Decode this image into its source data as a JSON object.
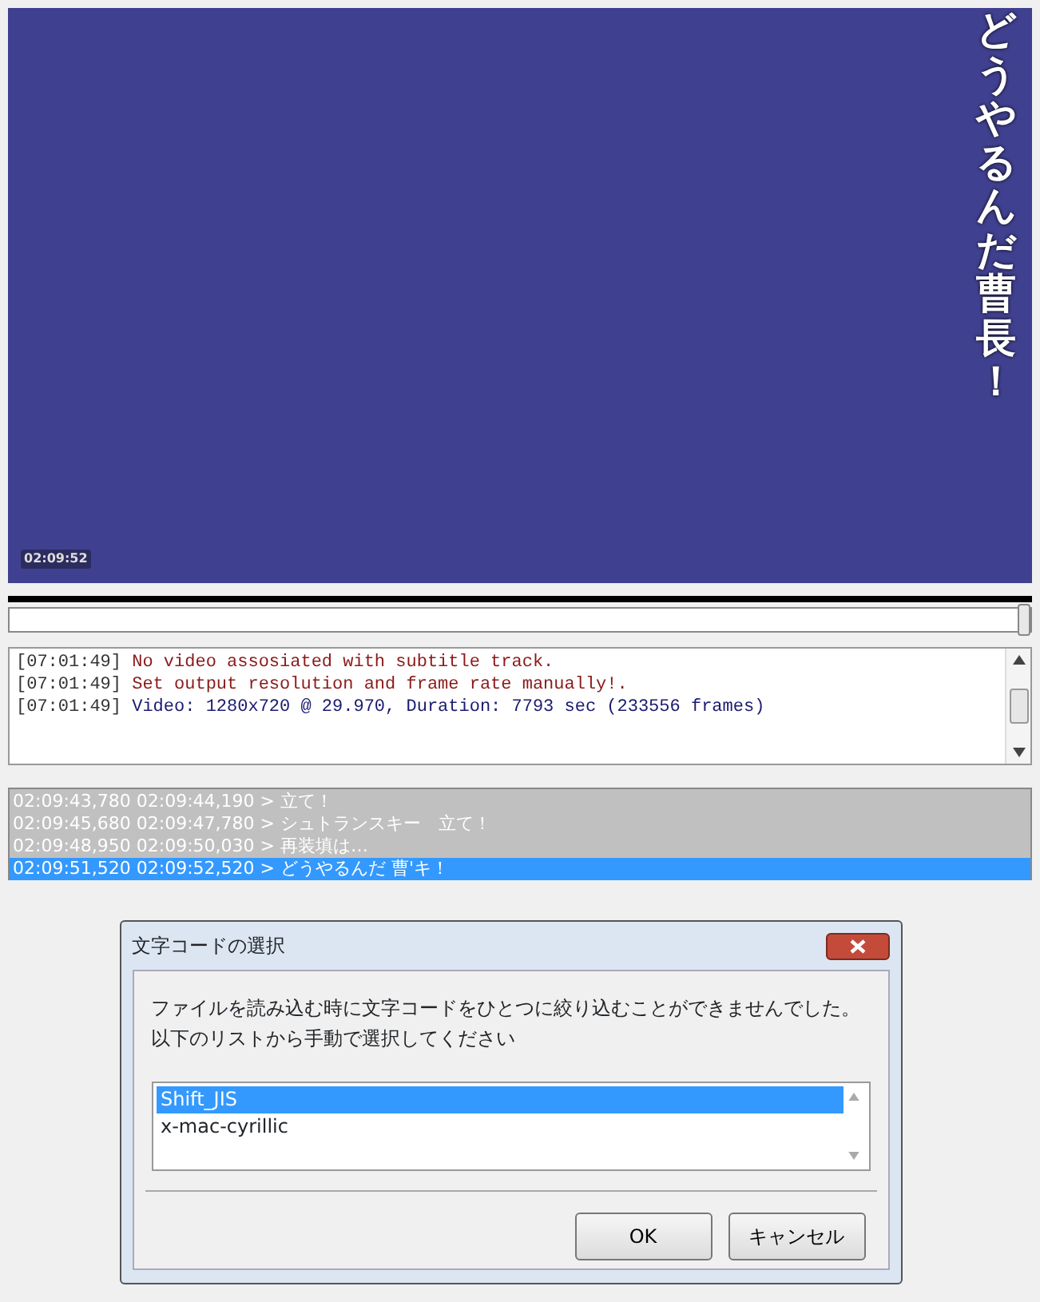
{
  "video": {
    "subtitle": "どうやるんだ曹長！",
    "timecode": "02:09:52"
  },
  "seek": {
    "level": 1.0
  },
  "log": [
    {
      "time": "[07:01:49]",
      "message": "No video assosiated with subtitle track.",
      "kind": "warning"
    },
    {
      "time": "[07:01:49]",
      "message": "Set output resolution and frame rate manually!.",
      "kind": "warning"
    },
    {
      "time": "[07:01:49]",
      "message": "Video: 1280x720 @ 29.970, Duration: 7793 sec (233556 frames)",
      "kind": "info"
    }
  ],
  "subtitles": [
    {
      "text": "02:09:43,780 02:09:44,190 > 立て！",
      "selected": false
    },
    {
      "text": "02:09:45,680 02:09:47,780 > シュトランスキー　立て！",
      "selected": false
    },
    {
      "text": "02:09:48,950 02:09:50,030 > 再装填は…",
      "selected": false
    },
    {
      "text": "02:09:51,520 02:09:52,520 > どうやるんだ 曹'キ！",
      "selected": true
    }
  ],
  "dialog": {
    "title": "文字コードの選択",
    "message": [
      "ファイルを読み込む時に文字コードをひとつに絞り込むことができませんでした。",
      "以下のリストから手動で選択してください"
    ],
    "encodings": [
      {
        "label": "Shift_JIS",
        "selected": true
      },
      {
        "label": "x-mac-cyrillic",
        "selected": false
      }
    ],
    "buttons": [
      "OK",
      "キャンセル"
    ]
  }
}
